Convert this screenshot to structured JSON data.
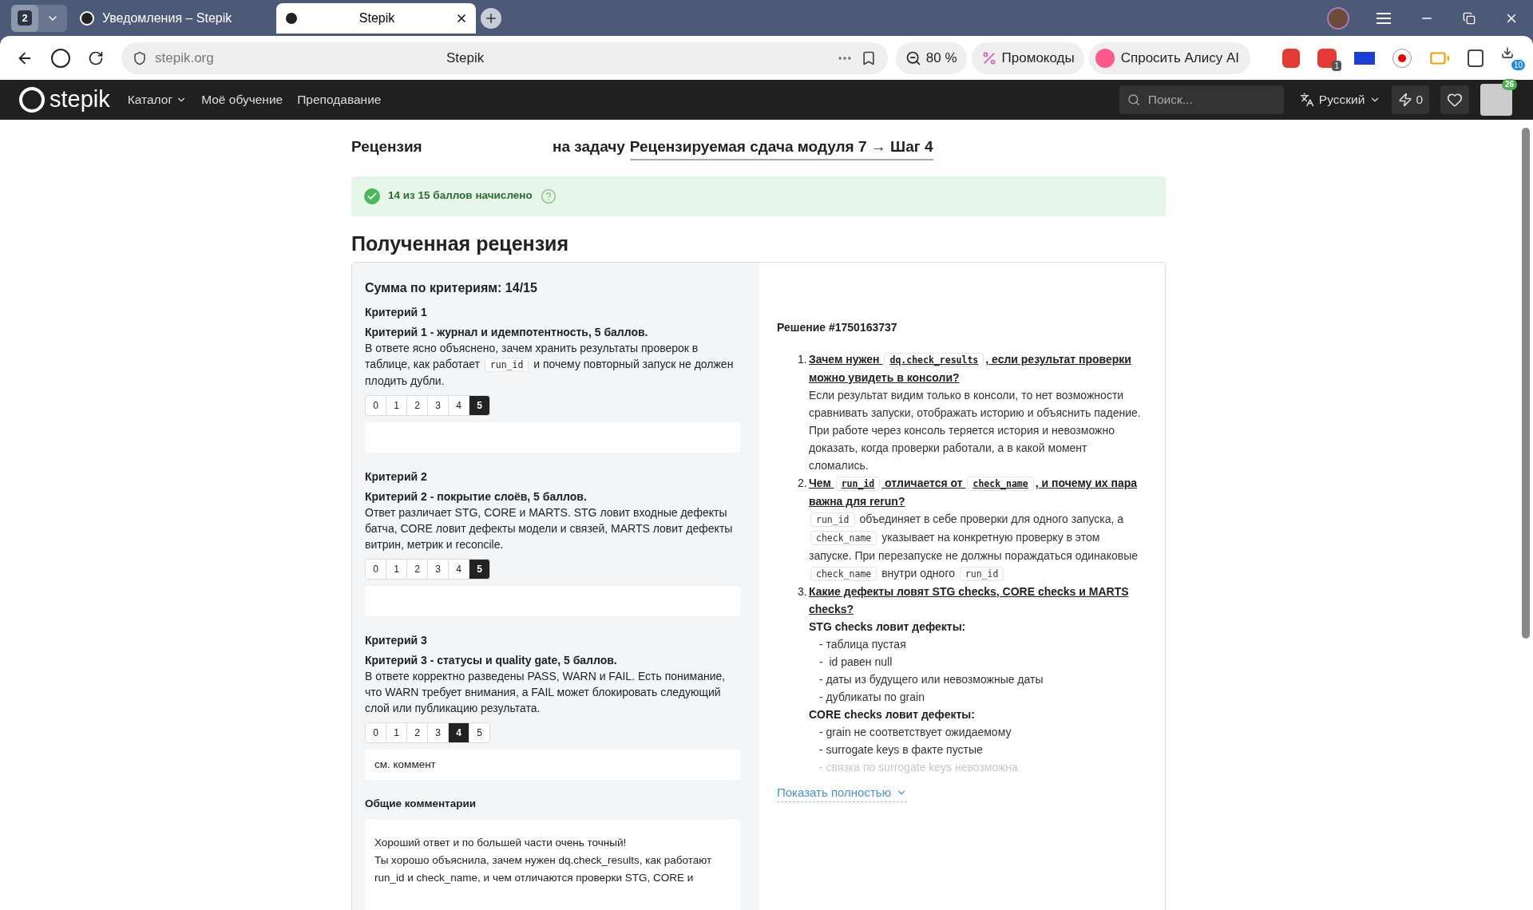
{
  "browser": {
    "tab_count": "2",
    "tabs": [
      {
        "title": "Уведомления – Stepik",
        "selected": false
      },
      {
        "title": "Stepik",
        "selected": true
      }
    ],
    "url": "stepik.org",
    "page_title": "Stepik",
    "zoom": "80 %",
    "promo": "Промокоды",
    "alice": "Спросить Алису AI",
    "adblock_badge": "1",
    "downloads_badge": "10"
  },
  "nav": {
    "logo": "stepik",
    "links": [
      {
        "label": "Каталог",
        "dropdown": true
      },
      {
        "label": "Моё обучение",
        "dropdown": false
      },
      {
        "label": "Преподавание",
        "dropdown": false
      }
    ],
    "search_placeholder": "Поиск...",
    "language": "Русский",
    "energy": "0",
    "avatar_badge": "26"
  },
  "review": {
    "title": "Рецензия",
    "task_prefix": "на задачу",
    "task_link": "Рецензируемая сдача модуля 7 → Шаг 4",
    "score_banner": "14 из 15 баллов начислено",
    "heading": "Полученная рецензия",
    "total_label": "Сумма по критериям:",
    "total": "14/15",
    "criteria": [
      {
        "title": "Критерий 1",
        "heading": "Критерий 1 - журнал и идемпотентность, 5 баллов.",
        "description": [
          {
            "kind": "text",
            "text": "В ответе ясно объяснено, зачем хранить результаты проверок в таблице, как работает "
          },
          {
            "kind": "code",
            "text": "run_id"
          },
          {
            "kind": "text",
            "text": " и почему повторный запуск не должен плодить дубли."
          }
        ],
        "scores": [
          {
            "label": "0",
            "selected": false
          },
          {
            "label": "1",
            "selected": false
          },
          {
            "label": "2",
            "selected": false
          },
          {
            "label": "3",
            "selected": false
          },
          {
            "label": "4",
            "selected": false
          },
          {
            "label": "5",
            "selected": true
          }
        ]
      },
      {
        "title": "Критерий 2",
        "heading": "Критерий 2 - покрытие слоёв, 5 баллов.",
        "description": [
          {
            "kind": "text",
            "text": "Ответ различает STG, CORE и MARTS. STG ловит входные дефекты батча, CORE ловит дефекты модели и связей, MARTS ловит дефекты витрин, метрик и reconcile."
          }
        ],
        "scores": [
          {
            "label": "0",
            "selected": false
          },
          {
            "label": "1",
            "selected": false
          },
          {
            "label": "2",
            "selected": false
          },
          {
            "label": "3",
            "selected": false
          },
          {
            "label": "4",
            "selected": false
          },
          {
            "label": "5",
            "selected": true
          }
        ]
      },
      {
        "title": "Критерий 3",
        "heading": "Критерий 3 - статусы и quality gate, 5 баллов.",
        "description": [
          {
            "kind": "text",
            "text": "В ответе корректно разведены PASS, WARN и FAIL. Есть понимание, что WARN требует внимания, а FAIL может блокировать следующий слой или публикацию результата."
          }
        ],
        "scores": [
          {
            "label": "0",
            "selected": false
          },
          {
            "label": "1",
            "selected": false
          },
          {
            "label": "2",
            "selected": false
          },
          {
            "label": "3",
            "selected": false
          },
          {
            "label": "4",
            "selected": true
          },
          {
            "label": "5",
            "selected": false
          }
        ],
        "comment": "см. коммент"
      }
    ],
    "general_label": "Общие комментарии",
    "general_comment": [
      "Хороший ответ и по большей части очень точный!",
      "Ты хорошо объяснила, зачем нужен dq.check_results, как работают run_id и check_name, и чем отличаются проверки STG, CORE и"
    ]
  },
  "solution": {
    "title": "Решение #1750163737",
    "items": [
      {
        "number": "1.",
        "question": [
          {
            "kind": "text",
            "text": "Зачем нужен "
          },
          {
            "kind": "code",
            "text": "dq.check_results"
          },
          {
            "kind": "text",
            "text": ", если результат проверки можно увидеть в консоли?"
          }
        ],
        "blocks": [
          {
            "kind": "paragraph",
            "faded": false,
            "parts": [
              {
                "kind": "text",
                "text": "Если результат видим только в консоли, то нет возможности сравнивать запуски, отображать историю и объяснить падение. При работе через консоль теряется история и невозможно доказать, когда проверки работали, а в какой момент сломались."
              }
            ]
          }
        ]
      },
      {
        "number": "2.",
        "question": [
          {
            "kind": "text",
            "text": "Чем "
          },
          {
            "kind": "code",
            "text": "run_id"
          },
          {
            "kind": "text",
            "text": " отличается от "
          },
          {
            "kind": "code",
            "text": "check_name"
          },
          {
            "kind": "text",
            "text": ", и почему их пара важна для rerun?"
          }
        ],
        "blocks": [
          {
            "kind": "paragraph",
            "faded": false,
            "parts": [
              {
                "kind": "code",
                "text": "run_id"
              },
              {
                "kind": "text",
                "text": " объединяет в себе проверки для одного запуска, а "
              },
              {
                "kind": "code",
                "text": "check_name"
              },
              {
                "kind": "text",
                "text": " указывает на конкретную проверку в этом запуске. При перезапуске не должны пораждаться одинаковые "
              },
              {
                "kind": "code",
                "text": "check_name"
              },
              {
                "kind": "text",
                "text": " внутри одного "
              },
              {
                "kind": "code",
                "text": "run_id"
              }
            ]
          }
        ]
      },
      {
        "number": "3.",
        "question": [
          {
            "kind": "text",
            "text": "Какие дефекты ловят STG checks, CORE checks и MARTS checks?"
          }
        ],
        "blocks": [
          {
            "kind": "subheading",
            "faded": false,
            "text": "STG checks ловит дефекты:"
          },
          {
            "kind": "bullet",
            "faded": false,
            "text": "- таблица пустая"
          },
          {
            "kind": "bullet",
            "faded": false,
            "text": "-  id равен null"
          },
          {
            "kind": "bullet",
            "faded": false,
            "text": "- даты из будущего или невозможные даты"
          },
          {
            "kind": "bullet",
            "faded": false,
            "text": "- дубликаты по grain"
          },
          {
            "kind": "subheading",
            "faded": false,
            "text": "CORE checks ловит дефекты:"
          },
          {
            "kind": "bullet",
            "faded": false,
            "text": "- grain не соответствует ожидаемому"
          },
          {
            "kind": "bullet",
            "faded": false,
            "text": "- surrogate keys в факте пустые"
          },
          {
            "kind": "bullet",
            "faded": true,
            "text": "- связка по surrogate keys невозможна"
          }
        ]
      }
    ],
    "show_more": "Показать полностью"
  }
}
